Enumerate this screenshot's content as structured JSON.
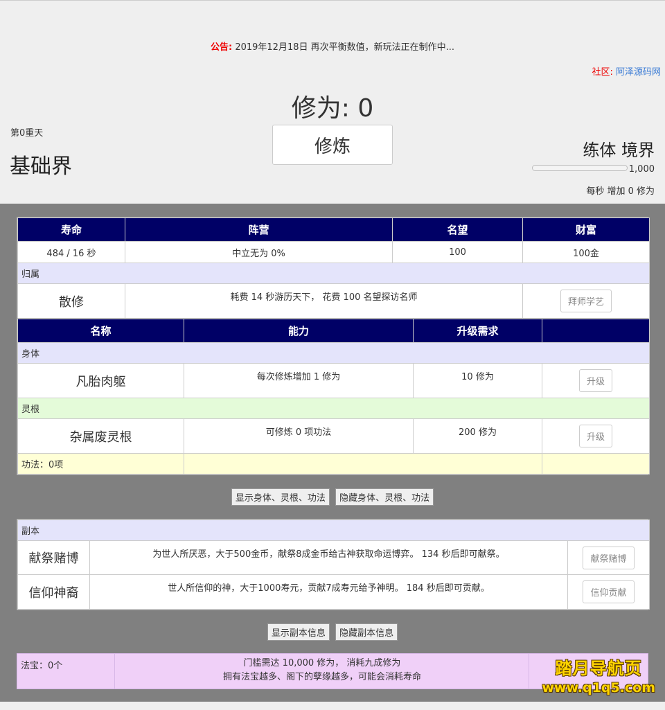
{
  "header": {
    "notice_label": "公告:",
    "notice_text": "2019年12月18日 再次平衡数值，新玩法正在制作中...",
    "community_label": "社区:",
    "community_link": "阿泽源码网",
    "xiuwei": "修为: 0",
    "cultivate_button": "修炼",
    "layer": "第0重天",
    "realm": "基础界",
    "jingjie": "练体 境界",
    "progress_max": "1,000",
    "progress_fraction": 0,
    "per_second": "每秒 增加 0 修为"
  },
  "status_table": {
    "headers": [
      "寿命",
      "阵营",
      "名望",
      "财富"
    ],
    "values": [
      "484 / 16 秒",
      "中立无为 0%",
      "100",
      "100金"
    ],
    "belong_label": "归属",
    "belong_name": "散修",
    "belong_desc": "耗费 14 秒游历天下， 花费 100 名望探访名师",
    "belong_button": "拜师学艺"
  },
  "ability_table": {
    "headers": [
      "名称",
      "能力",
      "升级需求",
      ""
    ],
    "body_label": "身体",
    "body_name": "凡胎肉躯",
    "body_ability": "每次修炼增加 1 修为",
    "body_req": "10 修为",
    "body_button": "升级",
    "root_label": "灵根",
    "root_name": "杂属废灵根",
    "root_ability": "可修炼 0 项功法",
    "root_req": "200 修为",
    "root_button": "升级",
    "gongfa_label": "功法：0项"
  },
  "toggles1": {
    "show": "显示身体、灵根、功法",
    "hide": "隐藏身体、灵根、功法"
  },
  "dungeon": {
    "label": "副本",
    "rows": [
      {
        "name": "献祭赌博",
        "desc": "为世人所厌恶，大于500金币，献祭8成金币给古神获取命运博弈。 134 秒后即可献祭。",
        "button": "献祭赌博"
      },
      {
        "name": "信仰神裔",
        "desc": "世人所信仰的神，大于1000寿元，贡献7成寿元给予神明。 184 秒后即可贡献。",
        "button": "信仰贡献"
      }
    ]
  },
  "toggles2": {
    "show": "显示副本信息",
    "hide": "隐藏副本信息"
  },
  "fabao": {
    "label": "法宝：0个",
    "line1": "门槛需达 10,000 修为， 消耗九成修为",
    "line2": "拥有法宝越多、阁下的孽缘越多，可能会消耗寿命"
  },
  "watermark": {
    "line1": "踏月导航页",
    "line2": "www.q1q5.com"
  }
}
